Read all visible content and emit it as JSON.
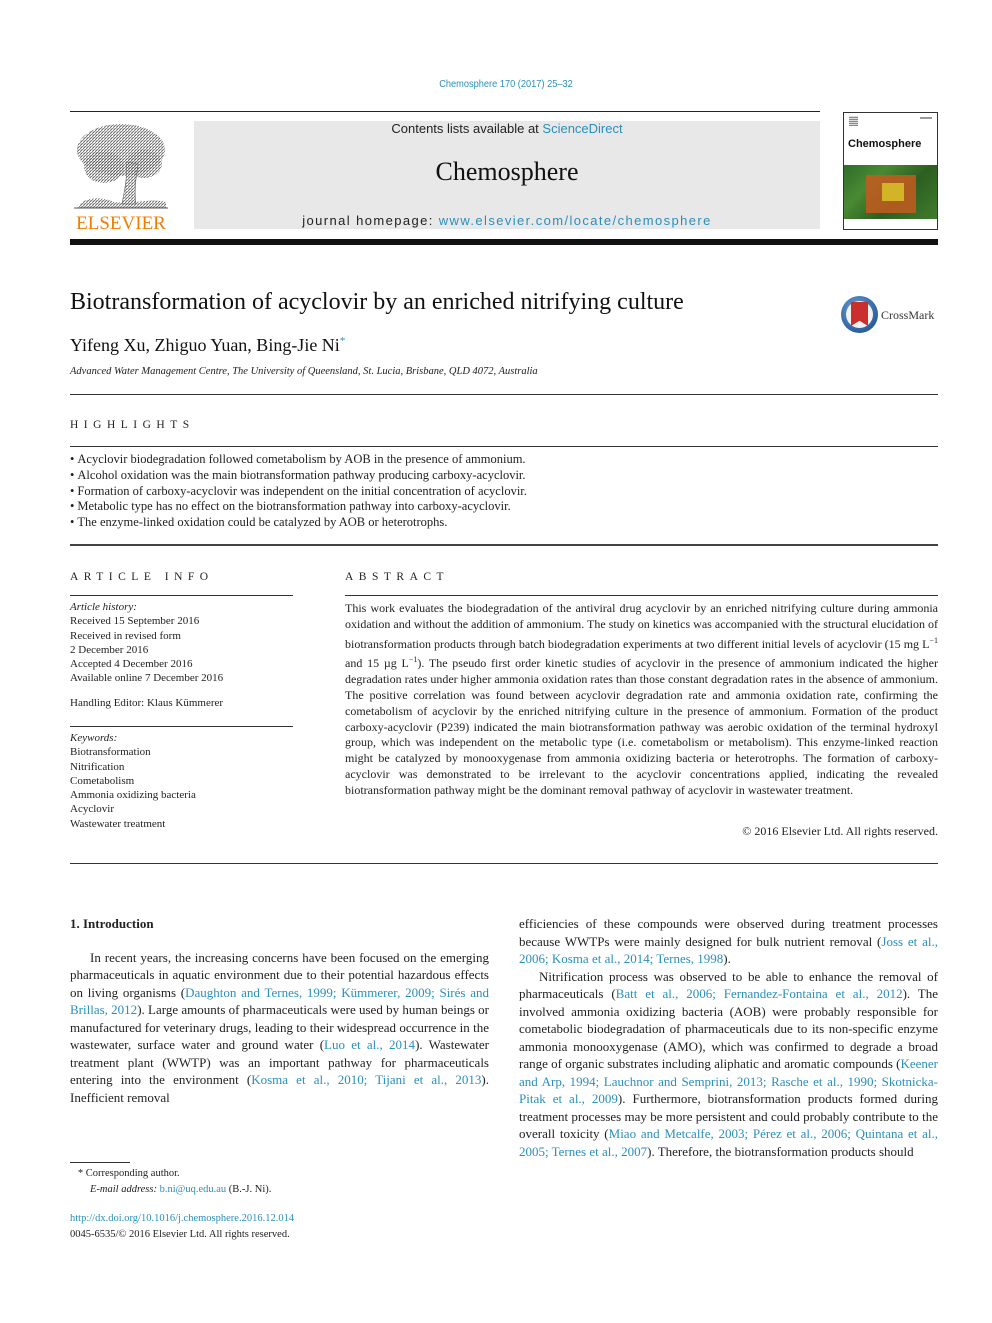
{
  "running_head": "Chemosphere 170 (2017) 25–32",
  "masthead": {
    "publisher": "ELSEVIER",
    "contents_prefix": "Contents lists available at ",
    "contents_link": "ScienceDirect",
    "journal": "Chemosphere",
    "homepage_prefix": "journal homepage: ",
    "homepage_link": "www.elsevier.com/locate/chemosphere",
    "cover_title": "Chemosphere"
  },
  "article": {
    "title": "Biotransformation of acyclovir by an enriched nitrifying culture",
    "authors": "Yifeng Xu, Zhiguo Yuan, Bing-Jie Ni",
    "author_mark": "*",
    "affiliation": "Advanced Water Management Centre, The University of Queensland, St. Lucia, Brisbane, QLD 4072, Australia",
    "crossmark": "CrossMark"
  },
  "highlights": {
    "label": "HIGHLIGHTS",
    "items": [
      "Acyclovir biodegradation followed cometabolism by AOB in the presence of ammonium.",
      "Alcohol oxidation was the main biotransformation pathway producing carboxy-acyclovir.",
      "Formation of carboxy-acyclovir was independent on the initial concentration of acyclovir.",
      "Metabolic type has no effect on the biotransformation pathway into carboxy-acyclovir.",
      "The enzyme-linked oxidation could be catalyzed by AOB or heterotrophs."
    ]
  },
  "article_info": {
    "label": "ARTICLE INFO",
    "history_label": "Article history:",
    "history": [
      "Received 15 September 2016",
      "Received in revised form",
      "2 December 2016",
      "Accepted 4 December 2016",
      "Available online 7 December 2016"
    ],
    "editor": "Handling Editor: Klaus Kümmerer",
    "keywords_label": "Keywords:",
    "keywords": [
      "Biotransformation",
      "Nitrification",
      "Cometabolism",
      "Ammonia oxidizing bacteria",
      "Acyclovir",
      "Wastewater treatment"
    ]
  },
  "abstract": {
    "label": "ABSTRACT",
    "part1": "This work evaluates the biodegradation of the antiviral drug acyclovir by an enriched nitrifying culture during ammonia oxidation and without the addition of ammonium. The study on kinetics was accompanied with the structural elucidation of biotransformation products through batch biodegradation experiments at two different initial levels of acyclovir (15 mg L",
    "sup1": "−1",
    "part2": " and 15 µg L",
    "sup2": "−1",
    "part3": "). The pseudo first order kinetic studies of acyclovir in the presence of ammonium indicated the higher degradation rates under higher ammonia oxidation rates than those constant degradation rates in the absence of ammonium. The positive correlation was found between acyclovir degradation rate and ammonia oxidation rate, confirming the cometabolism of acyclovir by the enriched nitrifying culture in the presence of ammonium. Formation of the product carboxy-acyclovir (P239) indicated the main biotransformation pathway was aerobic oxidation of the terminal hydroxyl group, which was independent on the metabolic type (i.e. cometabolism or metabolism). This enzyme-linked reaction might be catalyzed by monooxygenase from ammonia oxidizing bacteria or heterotrophs. The formation of carboxy-acyclovir was demonstrated to be irrelevant to the acyclovir concentrations applied, indicating the revealed biotransformation pathway might be the dominant removal pathway of acyclovir in wastewater treatment.",
    "copyright": "© 2016 Elsevier Ltd. All rights reserved."
  },
  "body": {
    "section_heading": "1.  Introduction",
    "left": {
      "t1": "In recent years, the increasing concerns have been focused on the emerging pharmaceuticals in aquatic environment due to their potential hazardous effects on living organisms (",
      "c1": "Daughton and Ternes, 1999; Kümmerer, 2009; Sirés and Brillas, 2012",
      "t2": "). Large amounts of pharmaceuticals were used by human beings or manufactured for veterinary drugs, leading to their widespread occurrence in the wastewater, surface water and ground water (",
      "c2": "Luo et al., 2014",
      "t3": "). Wastewater treatment plant (WWTP) was an important pathway for pharmaceuticals entering into the environment (",
      "c3": "Kosma et al., 2010; Tijani et al., 2013",
      "t4": "). Inefficient removal"
    },
    "right": {
      "p1_t1": "efficiencies of these compounds were observed during treatment processes because WWTPs were mainly designed for bulk nutrient removal (",
      "p1_c1": "Joss et al., 2006; Kosma et al., 2014; Ternes, 1998",
      "p1_t2": ").",
      "p2_t1": "Nitrification process was observed to be able to enhance the removal of pharmaceuticals (",
      "p2_c1": "Batt et al., 2006; Fernandez-Fontaina et al., 2012",
      "p2_t2": "). The involved ammonia oxidizing bacteria (AOB) were probably responsible for cometabolic biodegradation of pharmaceuticals due to its non-specific enzyme ammonia monooxygenase (AMO), which was confirmed to degrade a broad range of organic substrates including aliphatic and aromatic compounds (",
      "p2_c2": "Keener and Arp, 1994; Lauchnor and Semprini, 2013; Rasche et al., 1990; Skotnicka-Pitak et al., 2009",
      "p2_t3": "). Furthermore, biotransformation products formed during treatment processes may be more persistent and could probably contribute to the overall toxicity (",
      "p2_c3": "Miao and Metcalfe, 2003; Pérez et al., 2006; Quintana et al., 2005; Ternes et al., 2007",
      "p2_t4": "). Therefore, the biotransformation products should"
    }
  },
  "footnote": {
    "marker": "*",
    "corresponding": "Corresponding author.",
    "email_label": "E-mail address:",
    "email": "b.ni@uq.edu.au",
    "email_suffix": " (B.-J. Ni).",
    "doi": "http://dx.doi.org/10.1016/j.chemosphere.2016.12.014",
    "issn": "0045-6535/© 2016 Elsevier Ltd. All rights reserved."
  },
  "colors": {
    "link": "#2a8fbd",
    "elsevier_orange": "#f07c00",
    "masthead_bg": "#e8e8e8"
  }
}
